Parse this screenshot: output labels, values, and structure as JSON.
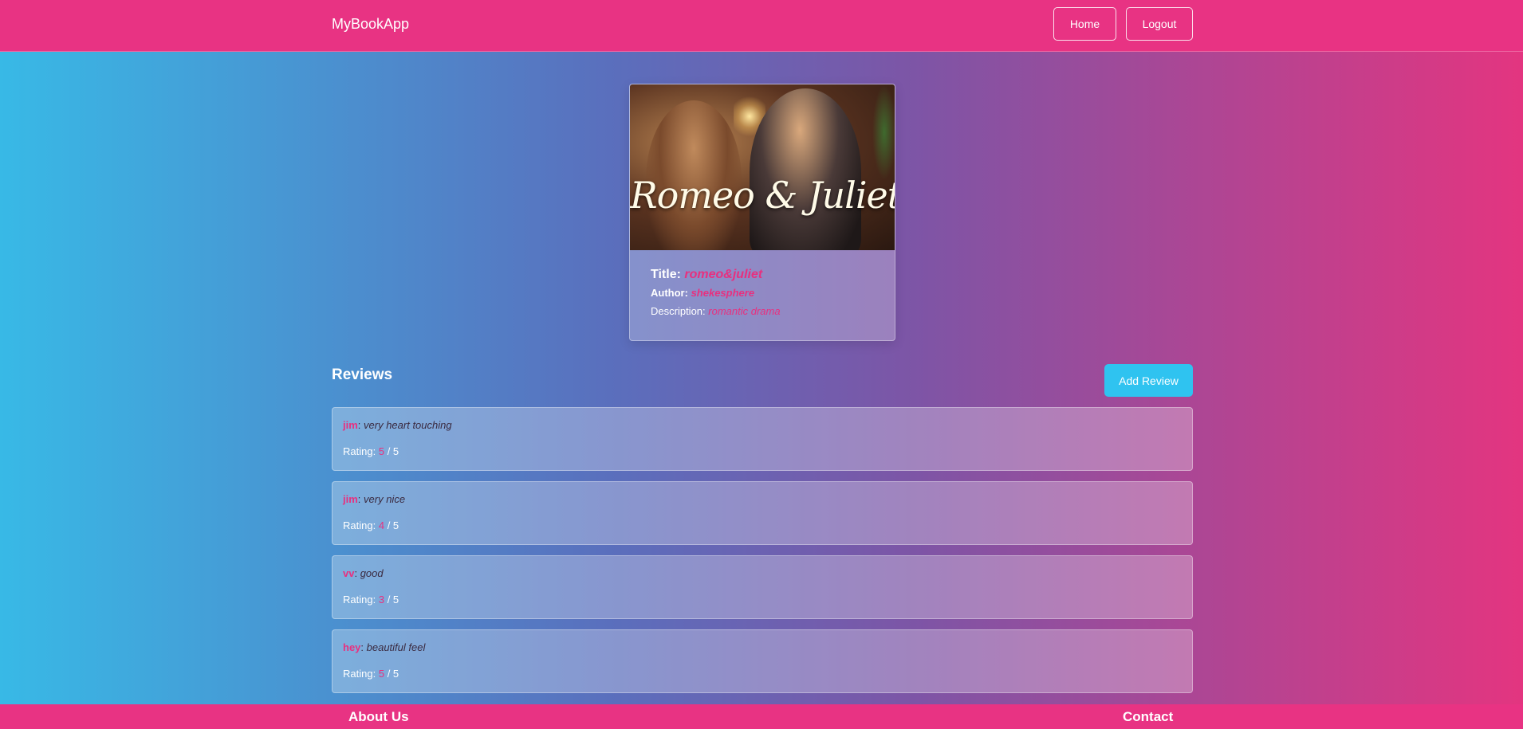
{
  "navbar": {
    "brand": "MyBookApp",
    "home_label": "Home",
    "logout_label": "Logout"
  },
  "book": {
    "cover_text": "Romeo & Juliet",
    "title_label": "Title:",
    "title": "romeo&juliet",
    "author_label": "Author:",
    "author": "shekesphere",
    "description_label": "Description:",
    "description": "romantic drama"
  },
  "reviews": {
    "heading": "Reviews",
    "add_label": "Add Review",
    "rating_label": "Rating:",
    "rating_max": "/ 5",
    "items": [
      {
        "user": "jim",
        "comment": "very heart touching",
        "rating": "5"
      },
      {
        "user": "jim",
        "comment": "very nice",
        "rating": "4"
      },
      {
        "user": "vv",
        "comment": "good",
        "rating": "3"
      },
      {
        "user": "hey",
        "comment": "beautiful feel",
        "rating": "5"
      }
    ]
  },
  "footer": {
    "about": "About Us",
    "contact": "Contact"
  },
  "colors": {
    "brand_pink": "#e83383",
    "accent_cyan": "#2fc3f0"
  }
}
